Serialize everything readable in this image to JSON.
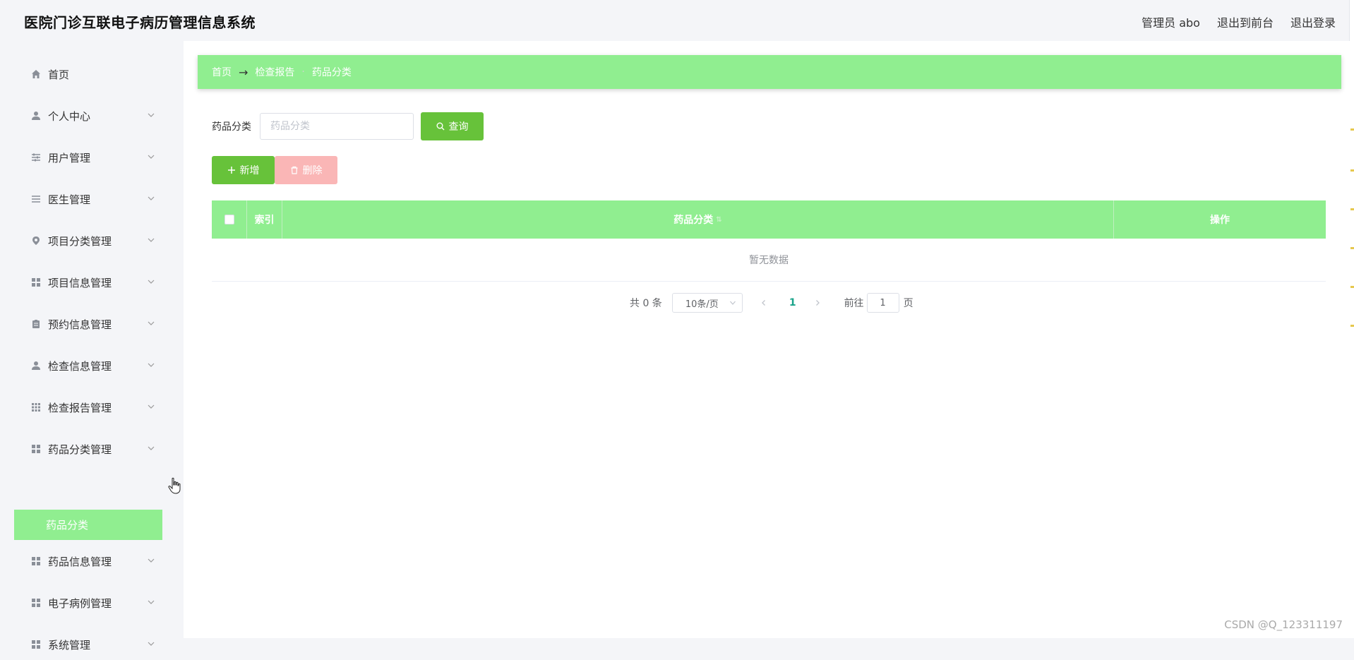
{
  "header": {
    "title": "医院门诊互联电子病历管理信息系统",
    "user_label": "管理员 abo",
    "front_label": "退出到前台",
    "logout_label": "退出登录"
  },
  "sidebar": {
    "items": [
      {
        "label": "首页",
        "icon": "home-icon"
      },
      {
        "label": "个人中心",
        "icon": "user-icon"
      },
      {
        "label": "用户管理",
        "icon": "sliders-icon"
      },
      {
        "label": "医生管理",
        "icon": "list-icon"
      },
      {
        "label": "项目分类管理",
        "icon": "location-icon"
      },
      {
        "label": "项目信息管理",
        "icon": "grid-icon"
      },
      {
        "label": "预约信息管理",
        "icon": "clipboard-icon"
      },
      {
        "label": "检查信息管理",
        "icon": "user-icon"
      },
      {
        "label": "检查报告管理",
        "icon": "grid-icon"
      },
      {
        "label": "药品分类管理",
        "icon": "grid-icon"
      },
      {
        "label": "药品信息管理",
        "icon": "grid-icon"
      },
      {
        "label": "电子病例管理",
        "icon": "grid-icon"
      },
      {
        "label": "系统管理",
        "icon": "grid-icon"
      }
    ],
    "active_sub": "药品分类"
  },
  "breadcrumb": {
    "items": [
      "首页",
      "检查报告",
      "药品分类"
    ]
  },
  "search": {
    "label": "药品分类",
    "placeholder": "药品分类",
    "value": "",
    "query_label": "查询"
  },
  "actions": {
    "add_label": "新增",
    "delete_label": "删除"
  },
  "table": {
    "columns": [
      "索引",
      "药品分类",
      "操作"
    ],
    "empty_text": "暂无数据"
  },
  "pagination": {
    "total_label": "共 0 条",
    "page_size": "10条/页",
    "current_page": "1",
    "goto_label": "前往",
    "goto_value": "1",
    "goto_suffix": "页"
  },
  "watermark": "CSDN @Q_123311197",
  "colors": {
    "accent": "#90ee90",
    "button_green": "#67c23a",
    "button_disabled": "#fab6b6"
  }
}
